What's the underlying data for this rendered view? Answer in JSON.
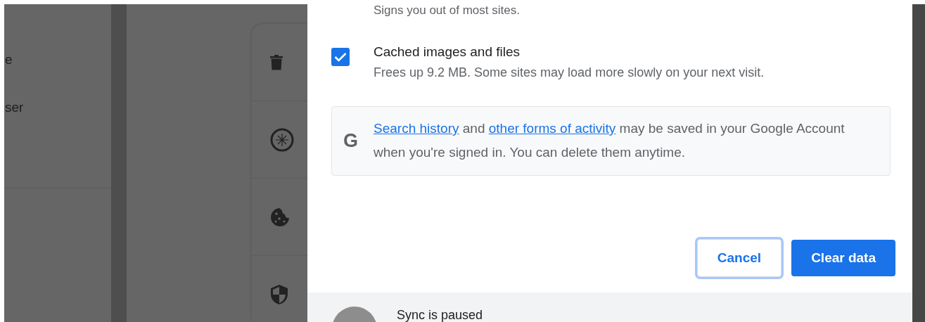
{
  "background": {
    "nav_items": [
      {
        "label": "e"
      },
      {
        "label": "ser"
      }
    ],
    "card_icons": [
      {
        "kind": "trash"
      },
      {
        "kind": "compass"
      },
      {
        "kind": "cookie"
      },
      {
        "kind": "shield"
      }
    ]
  },
  "dialog": {
    "cut_text": "Signs you out of most sites.",
    "options": [
      {
        "title": "Cached images and files",
        "description": "Frees up 9.2 MB. Some sites may load more slowly on your next visit.",
        "checked": true
      }
    ],
    "notice": {
      "logo": "G",
      "parts": [
        {
          "kind": "link",
          "text": "Search history"
        },
        {
          "kind": "text",
          "text": " and "
        },
        {
          "kind": "link",
          "text": "other forms of activity"
        },
        {
          "kind": "text",
          "text": " may be saved in your Google Account when you're signed in. You can delete them anytime."
        }
      ]
    },
    "buttons": [
      {
        "label": "Cancel",
        "kind": "secondary",
        "focused": true
      },
      {
        "label": "Clear data",
        "kind": "primary",
        "focused": false
      }
    ],
    "footer": {
      "status": "Sync is paused"
    }
  }
}
